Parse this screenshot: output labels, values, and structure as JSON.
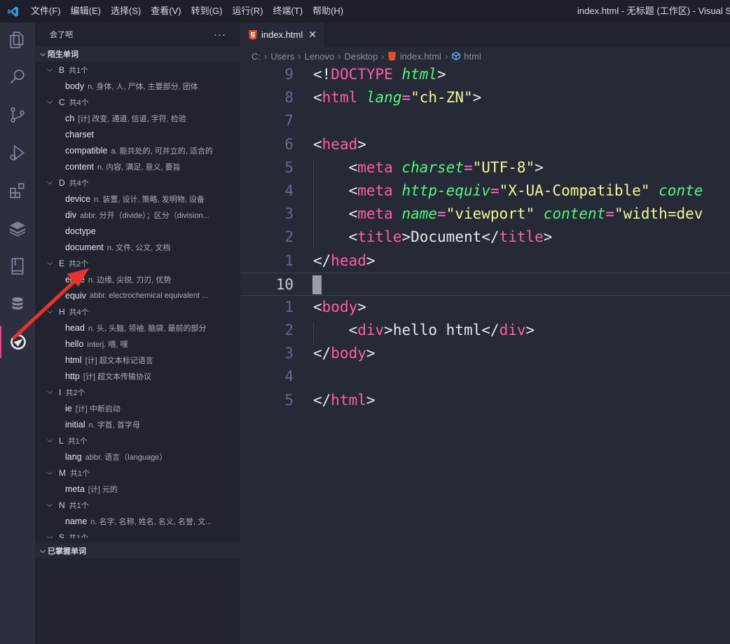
{
  "titlebar": {
    "menu": [
      "文件(F)",
      "编辑(E)",
      "选择(S)",
      "查看(V)",
      "转到(G)",
      "运行(R)",
      "终端(T)",
      "帮助(H)"
    ],
    "window_title": "index.html - 无标题 (工作区) - Visual Stu"
  },
  "sidebar": {
    "title": "会了吧",
    "more": "···",
    "section1": "陌生单词",
    "section2": "已掌握单词",
    "groups": [
      {
        "letter": "B",
        "count": "共1个",
        "words": [
          {
            "w": "body",
            "d": "n. 身体, 人, 尸体, 主要部分, 团体"
          }
        ]
      },
      {
        "letter": "C",
        "count": "共4个",
        "words": [
          {
            "w": "ch",
            "d": "[计] 改变, 通道, 信道, 字符, 检验"
          },
          {
            "w": "charset",
            "d": ""
          },
          {
            "w": "compatible",
            "d": "a. 能共处的, 可并立的, 适合的"
          },
          {
            "w": "content",
            "d": "n. 内容, 满足, 意义, 要旨"
          }
        ]
      },
      {
        "letter": "D",
        "count": "共4个",
        "words": [
          {
            "w": "device",
            "d": "n. 装置, 设计, 策略, 发明物, 设备"
          },
          {
            "w": "div",
            "d": "abbr. 分开（divide）；区分（division..."
          },
          {
            "w": "doctype",
            "d": ""
          },
          {
            "w": "document",
            "d": "n. 文件, 公文, 文档"
          }
        ]
      },
      {
        "letter": "E",
        "count": "共2个",
        "words": [
          {
            "w": "edge",
            "d": "n. 边缘, 尖锐, 刀刃, 优势"
          },
          {
            "w": "equiv",
            "d": "abbr. electrochemical equivalent ..."
          }
        ]
      },
      {
        "letter": "H",
        "count": "共4个",
        "words": [
          {
            "w": "head",
            "d": "n. 头, 头脑, 领袖, 脑袋, 最前的部分"
          },
          {
            "w": "hello",
            "d": "interj. 喂, 嘿"
          },
          {
            "w": "html",
            "d": "[计] 超文本标记语言"
          },
          {
            "w": "http",
            "d": "[计] 超文本传输协议"
          }
        ]
      },
      {
        "letter": "I",
        "count": "共2个",
        "words": [
          {
            "w": "ie",
            "d": "[计] 中断启动"
          },
          {
            "w": "initial",
            "d": "n. 字首, 首字母"
          }
        ]
      },
      {
        "letter": "L",
        "count": "共1个",
        "words": [
          {
            "w": "lang",
            "d": "abbr. 语言（language）"
          }
        ]
      },
      {
        "letter": "M",
        "count": "共1个",
        "words": [
          {
            "w": "meta",
            "d": "[计] 元的"
          }
        ]
      },
      {
        "letter": "N",
        "count": "共1个",
        "words": [
          {
            "w": "name",
            "d": "n. 名字, 名称, 姓名, 名义, 名誉, 文..."
          }
        ]
      },
      {
        "letter": "S",
        "count": "共1个",
        "words": []
      }
    ]
  },
  "editor": {
    "tab": "index.html",
    "breadcrumb": [
      "C:",
      "Users",
      "Lenovo",
      "Desktop",
      "index.html",
      "html"
    ],
    "lines": [
      {
        "n": "9",
        "html": "<span class='pn'>&lt;!</span><span class='kw'>DOCTYPE</span> <span class='at'>html</span><span class='pn'>&gt;</span>"
      },
      {
        "n": "8",
        "html": "<span class='pn'>&lt;</span><span class='tg'>html</span> <span class='at'>lang</span><span class='eq'>=</span><span class='st'>\"ch-ZN\"</span><span class='pn'>&gt;</span>"
      },
      {
        "n": "7",
        "html": ""
      },
      {
        "n": "6",
        "html": "<span class='pn'>&lt;</span><span class='tg'>head</span><span class='pn'>&gt;</span>"
      },
      {
        "n": "5",
        "html": "    <span class='pn'>&lt;</span><span class='tg'>meta</span> <span class='at'>charset</span><span class='eq'>=</span><span class='st'>\"UTF-8\"</span><span class='pn'>&gt;</span>"
      },
      {
        "n": "4",
        "html": "    <span class='pn'>&lt;</span><span class='tg'>meta</span> <span class='at'>http-equiv</span><span class='eq'>=</span><span class='st'>\"X-UA-Compatible\"</span> <span class='at'>conte</span>"
      },
      {
        "n": "3",
        "html": "    <span class='pn'>&lt;</span><span class='tg'>meta</span> <span class='at'>name</span><span class='eq'>=</span><span class='st'>\"viewport\"</span> <span class='at'>content</span><span class='eq'>=</span><span class='st'>\"width=dev</span>"
      },
      {
        "n": "2",
        "html": "    <span class='pn'>&lt;</span><span class='tg'>title</span><span class='pn'>&gt;</span><span class='tx'>Document</span><span class='pn'>&lt;/</span><span class='tg'>title</span><span class='pn'>&gt;</span>"
      },
      {
        "n": "1",
        "html": "<span class='pn'>&lt;/</span><span class='tg'>head</span><span class='pn'>&gt;</span>"
      },
      {
        "n": "10",
        "html": "",
        "current": true
      },
      {
        "n": "1",
        "html": "<span class='pn'>&lt;</span><span class='tg'>body</span><span class='pn'>&gt;</span>"
      },
      {
        "n": "2",
        "html": "    <span class='pn'>&lt;</span><span class='tg'>div</span><span class='pn'>&gt;</span><span class='tx'>hello html</span><span class='pn'>&lt;/</span><span class='tg'>div</span><span class='pn'>&gt;</span>"
      },
      {
        "n": "3",
        "html": "<span class='pn'>&lt;/</span><span class='tg'>body</span><span class='pn'>&gt;</span>"
      },
      {
        "n": "4",
        "html": ""
      },
      {
        "n": "5",
        "html": "<span class='pn'>&lt;/</span><span class='tg'>html</span><span class='pn'>&gt;</span>"
      }
    ]
  },
  "colors": {
    "accent": "#e8478b",
    "annotation_arrow": "#e8322c"
  }
}
